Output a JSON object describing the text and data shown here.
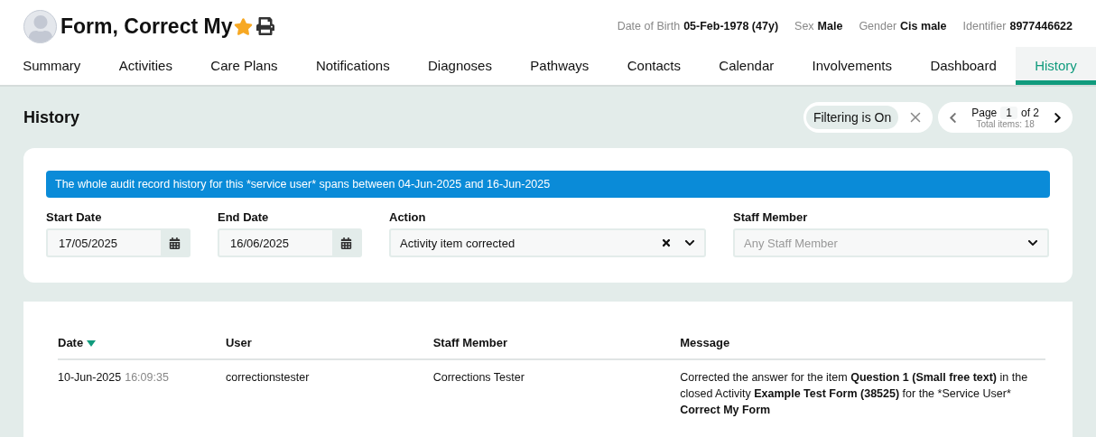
{
  "patient": {
    "name": "Form, Correct My",
    "favourite": true,
    "details": [
      {
        "label": "Date of Birth",
        "value": "05-Feb-1978 (47y)"
      },
      {
        "label": "Sex",
        "value": "Male"
      },
      {
        "label": "Gender",
        "value": "Cis male"
      },
      {
        "label": "Identifier",
        "value": "8977446622"
      }
    ]
  },
  "tabs": [
    {
      "label": "Summary",
      "selected": false
    },
    {
      "label": "Activities",
      "selected": false
    },
    {
      "label": "Care Plans",
      "selected": false
    },
    {
      "label": "Notifications",
      "selected": false
    },
    {
      "label": "Diagnoses",
      "selected": false
    },
    {
      "label": "Pathways",
      "selected": false
    },
    {
      "label": "Contacts",
      "selected": false
    },
    {
      "label": "Calendar",
      "selected": false
    },
    {
      "label": "Involvements",
      "selected": false
    },
    {
      "label": "Dashboard",
      "selected": false
    },
    {
      "label": "History",
      "selected": true
    }
  ],
  "page_title": "History",
  "filter_chip": {
    "label": "Filtering is On"
  },
  "pager": {
    "page_label": "Page",
    "page": "1",
    "of": "of 2",
    "total": "Total items: 18"
  },
  "notice": "The whole audit record history for this *service user* spans between 04-Jun-2025 and 16-Jun-2025",
  "filters": [
    {
      "kind": "date",
      "label": "Start Date",
      "value": "17/05/2025"
    },
    {
      "kind": "date",
      "label": "End Date",
      "value": "16/06/2025"
    },
    {
      "kind": "select",
      "label": "Action",
      "value": "Activity item corrected"
    },
    {
      "kind": "select",
      "label": "Staff Member",
      "placeholder": "Any Staff Member"
    }
  ],
  "table": {
    "columns": [
      {
        "label": "Date",
        "sorted": true
      },
      {
        "label": "User",
        "sorted": false
      },
      {
        "label": "Staff Member",
        "sorted": false
      },
      {
        "label": "Message",
        "sorted": false
      }
    ],
    "rows": [
      {
        "date": "10-Jun-2025",
        "time": "16:09:35",
        "user": "correctionstester",
        "staff_member": "Corrections Tester",
        "message": [
          {
            "text": "Corrected the answer for the item ",
            "bold": false
          },
          {
            "text": "Question 1 (Small free text)",
            "bold": true
          },
          {
            "text": " in the closed Activity ",
            "bold": false
          },
          {
            "text": "Example Test Form (38525)",
            "bold": true
          },
          {
            "text": " for the *Service User* ",
            "bold": false
          },
          {
            "text": "Correct My Form",
            "bold": true
          }
        ]
      }
    ]
  }
}
